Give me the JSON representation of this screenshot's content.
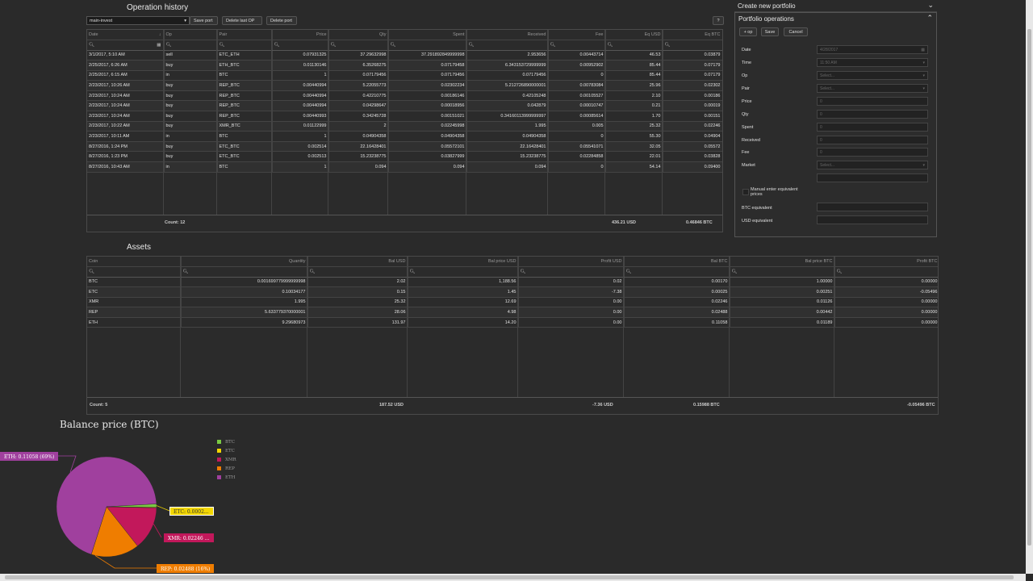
{
  "operation_history": {
    "title": "Operation history",
    "portfolio_select": "main-invest",
    "save_port": "Save port",
    "delete_last_op": "Delete last OP",
    "delete_port": "Delete port",
    "help": "?",
    "columns": [
      "Date",
      "Op",
      "Pair",
      "Price",
      "Qty",
      "Spent",
      "Received",
      "Fee",
      "Eq USD",
      "Eq BTC"
    ],
    "rows": [
      [
        "3/1/2017, 5:10 AM",
        "sell",
        "ETC_ETH",
        "0.07931325",
        "37.29632998",
        "37.291892849999998",
        "2.953656",
        "0.00443714",
        "46.53",
        "0.03879"
      ],
      [
        "2/25/2017, 6:26 AM",
        "buy",
        "ETH_BTC",
        "0.01130146",
        "6.35268275",
        "0.07179458",
        "6.343153729999999",
        "0.00952902",
        "85.44",
        "0.07179"
      ],
      [
        "2/25/2017, 6:15 AM",
        "in",
        "BTC",
        "1",
        "0.07179456",
        "0.07179456",
        "0.07179456",
        "0",
        "85.44",
        "0.07179"
      ],
      [
        "2/23/2017, 10:26 AM",
        "buy",
        "REP_BTC",
        "0.00440994",
        "5.22055773",
        "0.02302234",
        "5.212726890000001",
        "0.00783084",
        "25.96",
        "0.02302"
      ],
      [
        "2/23/2017, 10:24 AM",
        "buy",
        "REP_BTC",
        "0.00440994",
        "0.42210775",
        "0.00186146",
        "0.42105248",
        "0.00105527",
        "2.10",
        "0.00186"
      ],
      [
        "2/23/2017, 10:24 AM",
        "buy",
        "REP_BTC",
        "0.00440994",
        "0.04298647",
        "0.00018956",
        "0.042879",
        "0.00010747",
        "0.21",
        "0.00019"
      ],
      [
        "2/23/2017, 10:24 AM",
        "buy",
        "REP_BTC",
        "0.00440993",
        "0.34245728",
        "0.00151021",
        "0.34160113999999997",
        "0.00085614",
        "1.70",
        "0.00151"
      ],
      [
        "2/23/2017, 10:22 AM",
        "buy",
        "XMR_BTC",
        "0.01122999",
        "2",
        "0.02245998",
        "1.995",
        "0.005",
        "25.32",
        "0.02246"
      ],
      [
        "2/23/2017, 10:11 AM",
        "in",
        "BTC",
        "1",
        "0.04904358",
        "0.04904358",
        "0.04904358",
        "0",
        "55.30",
        "0.04904"
      ],
      [
        "8/27/2016, 1:24 PM",
        "buy",
        "ETC_BTC",
        "0.002514",
        "22.16428401",
        "0.05572101",
        "22.16428401",
        "0.05541071",
        "32.05",
        "0.05572"
      ],
      [
        "8/27/2016, 1:23 PM",
        "buy",
        "ETC_BTC",
        "0.002513",
        "15.23238775",
        "0.03827999",
        "15.23238775",
        "0.02284858",
        "22.01",
        "0.03828"
      ],
      [
        "8/27/2016, 10:43 AM",
        "in",
        "BTC",
        "1",
        "0.094",
        "0.094",
        "0.094",
        "0",
        "54.14",
        "0.09400"
      ]
    ],
    "footer_count": "Count: 12",
    "footer_usd": "436.21 USD",
    "footer_btc": "0.46846 BTC"
  },
  "assets": {
    "title": "Assets",
    "columns": [
      "Coin",
      "Quantity",
      "Bal USD",
      "Bal price USD",
      "Profit USD",
      "Bal BTC",
      "Bal price BTC",
      "Profit BTC"
    ],
    "rows": [
      [
        "BTC",
        "0.001699779999999998",
        "2.02",
        "1,188.56",
        "0.02",
        "0.00170",
        "1.00000",
        "0.00000"
      ],
      [
        "ETC",
        "0.10034177",
        "0.15",
        "1.45",
        "-7.38",
        "0.00025",
        "0.00251",
        "-0.05496"
      ],
      [
        "XMR",
        "1.995",
        "25.32",
        "12.69",
        "0.00",
        "0.02246",
        "0.01126",
        "0.00000"
      ],
      [
        "REP",
        "5.633779370000001",
        "28.06",
        "4.98",
        "0.00",
        "0.02488",
        "0.00442",
        "0.00000"
      ],
      [
        "ETH",
        "9.29680973",
        "131.97",
        "14.20",
        "0.00",
        "0.11058",
        "0.01189",
        "0.00000"
      ]
    ],
    "footer_count": "Count: 5",
    "footer_bal_usd": "187.52 USD",
    "footer_profit_usd": "-7.36 USD",
    "footer_bal_btc": "0.15988 BTC",
    "footer_profit_btc": "-0.05496 BTC"
  },
  "right_panel": {
    "create_new_portfolio": "Create new portfolio",
    "portfolio_operations": "Portfolio operations",
    "add_op": "+ op",
    "save": "Save",
    "cancel": "Cancel",
    "fields": {
      "date_label": "Date",
      "date_value": "4/28/2017",
      "time_label": "Time",
      "time_value": "11:50 AM",
      "op_label": "Op",
      "op_placeholder": "Select...",
      "pair_label": "Pair",
      "pair_placeholder": "Select...",
      "price_label": "Price",
      "price_value": "0",
      "qty_label": "Qty",
      "qty_value": "0",
      "spent_label": "Spent",
      "spent_value": "0",
      "received_label": "Received",
      "received_value": "0",
      "fee_label": "Fee",
      "fee_value": "0",
      "market_label": "Market",
      "market_placeholder": "Select...",
      "manual_label": "Manual enter equivalent prices",
      "btc_equiv_label": "BTC equivalent",
      "usd_equiv_label": "USD equivalent"
    }
  },
  "chart_data": {
    "type": "pie",
    "title": "Balance price (BTC)",
    "series": [
      {
        "name": "BTC",
        "value": 0.0017,
        "color": "#7ac943"
      },
      {
        "name": "ETC",
        "value": 0.00025,
        "color": "#f2d600"
      },
      {
        "name": "XMR",
        "value": 0.02246,
        "color": "#c2185b"
      },
      {
        "name": "REP",
        "value": 0.02488,
        "color": "#ef7d00"
      },
      {
        "name": "ETH",
        "value": 0.11058,
        "color": "#a0409e"
      }
    ],
    "labels": {
      "ETH": "ETH: 0.11058 (69%)",
      "ETC": "ETC: 0.0002...",
      "XMR": "XMR: 0.02246 ...",
      "REP": "REP: 0.02488 (16%)"
    },
    "legend_position": "right"
  }
}
